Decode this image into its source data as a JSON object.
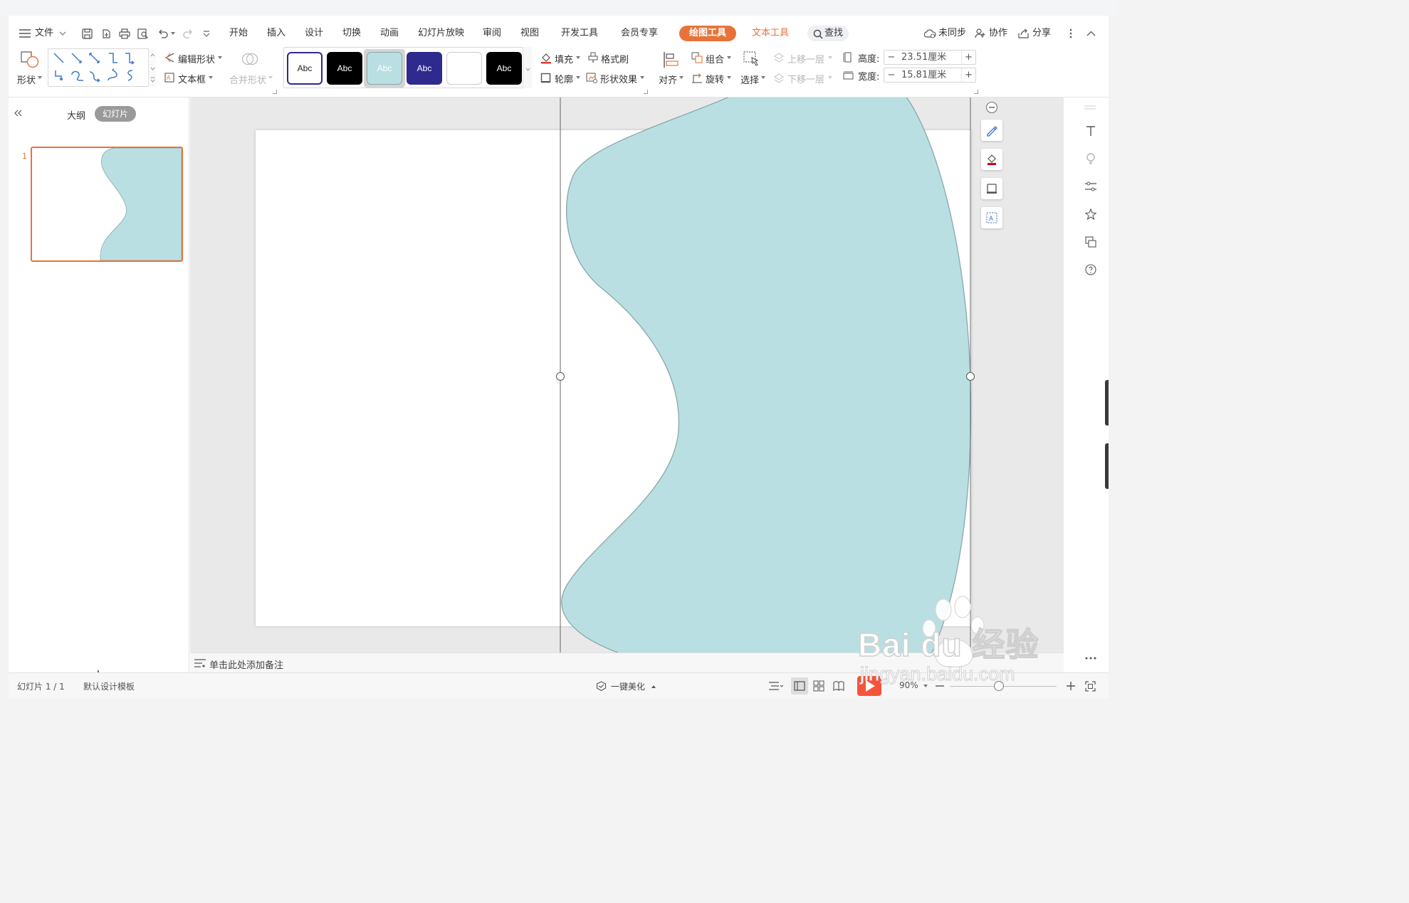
{
  "menu": {
    "file": "文件",
    "tabs": [
      "开始",
      "插入",
      "设计",
      "切换",
      "动画",
      "幻灯片放映",
      "审阅",
      "视图",
      "开发工具",
      "会员专享"
    ],
    "active_tab": "绘图工具",
    "text_tool_tab": "文本工具",
    "search": "查找",
    "sync": "未同步",
    "collab": "协作",
    "share": "分享"
  },
  "ribbon": {
    "shape": "形状",
    "edit_shape": "编辑形状",
    "text_box": "文本框",
    "merge_shape": "合并形状",
    "styles": [
      "Abc",
      "Abc",
      "Abc",
      "Abc",
      "",
      "Abc"
    ],
    "fill": "填充",
    "format_painter": "格式刷",
    "outline": "轮廓",
    "shape_effect": "形状效果",
    "align": "对齐",
    "group": "组合",
    "rotate": "旋转",
    "select": "选择",
    "bring_forward": "上移一层",
    "send_backward": "下移一层",
    "height_label": "高度:",
    "height_value": "23.51厘米",
    "width_label": "宽度:",
    "width_value": "15.81厘米"
  },
  "left_panel": {
    "outline_tab": "大纲",
    "slides_tab": "幻灯片",
    "slide_number": "1"
  },
  "notes": {
    "placeholder": "单击此处添加备注"
  },
  "status": {
    "slide_counter": "幻灯片 1 / 1",
    "template": "默认设计模板",
    "beautify": "一键美化",
    "zoom": "90%"
  },
  "colors": {
    "accent_orange": "#e8733a",
    "shape_fill": "#b9dfe2",
    "shape_stroke": "#8aa7a9",
    "style_navy": "#2e2a8e"
  },
  "watermark": {
    "brand": "Bai du 经验",
    "url": "jingyan.baidu.com"
  }
}
